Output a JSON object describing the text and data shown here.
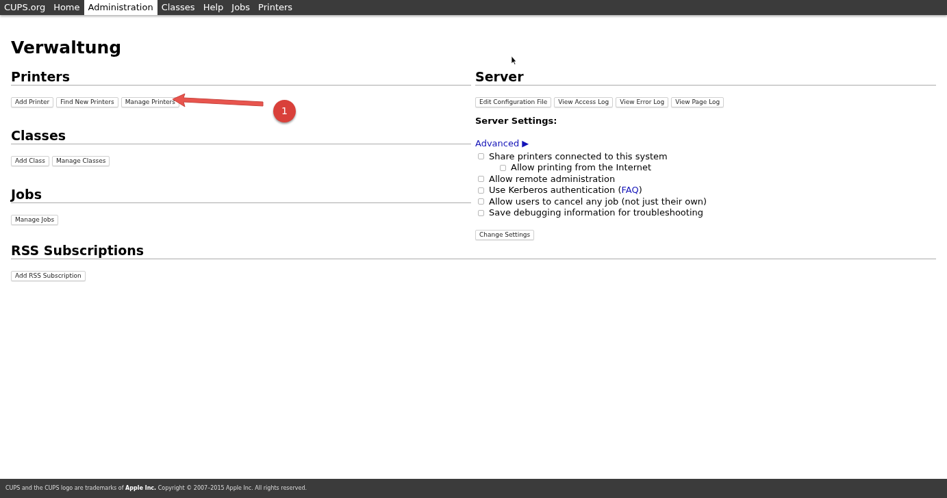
{
  "nav": [
    {
      "label": "CUPS.org",
      "selected": false
    },
    {
      "label": "Home",
      "selected": false
    },
    {
      "label": "Administration",
      "selected": true
    },
    {
      "label": "Classes",
      "selected": false
    },
    {
      "label": "Help",
      "selected": false
    },
    {
      "label": "Jobs",
      "selected": false
    },
    {
      "label": "Printers",
      "selected": false
    }
  ],
  "title": "Verwaltung",
  "left_sections": [
    {
      "heading": "Printers",
      "buttons": [
        "Add Printer",
        "Find New Printers",
        "Manage Printers"
      ]
    },
    {
      "heading": "Classes",
      "buttons": [
        "Add Class",
        "Manage Classes"
      ]
    },
    {
      "heading": "Jobs",
      "buttons": [
        "Manage Jobs"
      ]
    }
  ],
  "server": {
    "heading": "Server",
    "buttons": [
      "Edit Configuration File",
      "View Access Log",
      "View Error Log",
      "View Page Log"
    ],
    "settings_label": "Server Settings:",
    "advanced_link": "Advanced",
    "advanced_arrow": "▶",
    "options": [
      {
        "label": "Share printers connected to this system",
        "checked": false,
        "children": [
          {
            "label": "Allow printing from the Internet",
            "checked": false
          }
        ]
      },
      {
        "label": "Allow remote administration",
        "checked": false
      },
      {
        "label": "Use Kerberos authentication (",
        "link": "FAQ",
        "label_after": ")",
        "checked": false
      },
      {
        "label": "Allow users to cancel any job (not just their own)",
        "checked": false
      },
      {
        "label": "Save debugging information for troubleshooting",
        "checked": false
      }
    ],
    "submit": "Change Settings"
  },
  "rss": {
    "heading": "RSS Subscriptions",
    "buttons": [
      "Add RSS Subscription"
    ]
  },
  "annotation": {
    "number": "1"
  },
  "footer": "CUPS and the CUPS logo are trademarks of **Apple Inc.** Copyright © 2007–2015 Apple Inc. All rights reserved."
}
